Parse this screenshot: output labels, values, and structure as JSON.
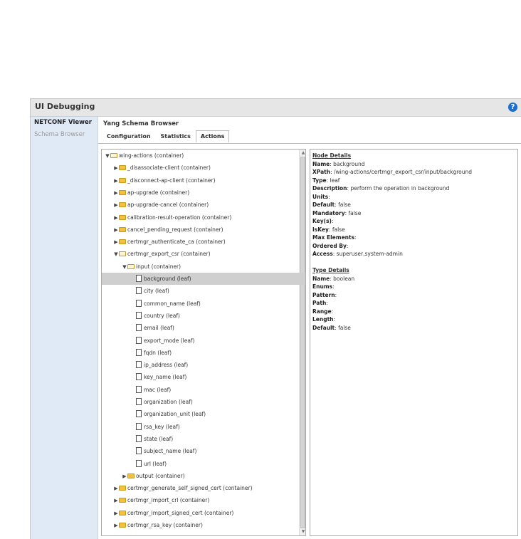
{
  "window": {
    "title": "UI Debugging",
    "help_icon": "?"
  },
  "sidebar": {
    "items": [
      {
        "label": "NETCONF Viewer",
        "active": true
      },
      {
        "label": "Schema Browser",
        "active": false
      }
    ]
  },
  "main": {
    "heading": "Yang Schema Browser",
    "tabs": [
      {
        "label": "Configuration",
        "active": false
      },
      {
        "label": "Statistics",
        "active": false
      },
      {
        "label": "Actions",
        "active": true
      }
    ]
  },
  "tree": [
    {
      "label": "wing-actions (container)",
      "depth": 0,
      "type": "folder",
      "open": true
    },
    {
      "label": "_disassociate-client (container)",
      "depth": 1,
      "type": "folder",
      "open": false
    },
    {
      "label": "_disconnect-ap-client (container)",
      "depth": 1,
      "type": "folder",
      "open": false
    },
    {
      "label": "ap-upgrade (container)",
      "depth": 1,
      "type": "folder",
      "open": false
    },
    {
      "label": "ap-upgrade-cancel (container)",
      "depth": 1,
      "type": "folder",
      "open": false
    },
    {
      "label": "calibration-result-operation (container)",
      "depth": 1,
      "type": "folder",
      "open": false
    },
    {
      "label": "cancel_pending_request (container)",
      "depth": 1,
      "type": "folder",
      "open": false
    },
    {
      "label": "certmgr_authenticate_ca (container)",
      "depth": 1,
      "type": "folder",
      "open": false
    },
    {
      "label": "certmgr_export_csr (container)",
      "depth": 1,
      "type": "folder",
      "open": true
    },
    {
      "label": "input (container)",
      "depth": 2,
      "type": "folder",
      "open": true
    },
    {
      "label": "background (leaf)",
      "depth": 3,
      "type": "leaf",
      "selected": true
    },
    {
      "label": "city (leaf)",
      "depth": 3,
      "type": "leaf"
    },
    {
      "label": "common_name (leaf)",
      "depth": 3,
      "type": "leaf"
    },
    {
      "label": "country (leaf)",
      "depth": 3,
      "type": "leaf"
    },
    {
      "label": "email (leaf)",
      "depth": 3,
      "type": "leaf"
    },
    {
      "label": "export_mode (leaf)",
      "depth": 3,
      "type": "leaf"
    },
    {
      "label": "fqdn (leaf)",
      "depth": 3,
      "type": "leaf"
    },
    {
      "label": "ip_address (leaf)",
      "depth": 3,
      "type": "leaf"
    },
    {
      "label": "key_name (leaf)",
      "depth": 3,
      "type": "leaf"
    },
    {
      "label": "mac (leaf)",
      "depth": 3,
      "type": "leaf"
    },
    {
      "label": "organization (leaf)",
      "depth": 3,
      "type": "leaf"
    },
    {
      "label": "organization_unit (leaf)",
      "depth": 3,
      "type": "leaf"
    },
    {
      "label": "rsa_key (leaf)",
      "depth": 3,
      "type": "leaf"
    },
    {
      "label": "state (leaf)",
      "depth": 3,
      "type": "leaf"
    },
    {
      "label": "subject_name (leaf)",
      "depth": 3,
      "type": "leaf"
    },
    {
      "label": "url (leaf)",
      "depth": 3,
      "type": "leaf"
    },
    {
      "label": "output (container)",
      "depth": 2,
      "type": "folder",
      "open": false
    },
    {
      "label": "certmgr_generate_self_signed_cert (container)",
      "depth": 1,
      "type": "folder",
      "open": false
    },
    {
      "label": "certmgr_import_crl (container)",
      "depth": 1,
      "type": "folder",
      "open": false
    },
    {
      "label": "certmgr_import_signed_cert (container)",
      "depth": 1,
      "type": "folder",
      "open": false
    },
    {
      "label": "certmgr_rsa_key (container)",
      "depth": 1,
      "type": "folder",
      "open": false
    }
  ],
  "details": {
    "node_title": "Node Details",
    "node": [
      {
        "k": "Name",
        "v": "background"
      },
      {
        "k": "XPath",
        "v": "/wing-actions/certmgr_export_csr/input/background"
      },
      {
        "k": "Type",
        "v": "leaf"
      },
      {
        "k": "Description",
        "v": "perform the operation in background"
      },
      {
        "k": "Units",
        "v": ""
      },
      {
        "k": "Default",
        "v": "false"
      },
      {
        "k": "Mandatory",
        "v": "false"
      },
      {
        "k": "Key(s)",
        "v": ""
      },
      {
        "k": "IsKey",
        "v": "false"
      },
      {
        "k": "Max Elements",
        "v": ""
      },
      {
        "k": "Ordered By",
        "v": ""
      },
      {
        "k": "Access",
        "v": "superuser,system-admin"
      }
    ],
    "type_title": "Type Details",
    "type": [
      {
        "k": "Name",
        "v": "boolean"
      },
      {
        "k": "Enums",
        "v": ""
      },
      {
        "k": "Pattern",
        "v": ""
      },
      {
        "k": "Path",
        "v": ""
      },
      {
        "k": "Range",
        "v": ""
      },
      {
        "k": "Length",
        "v": ""
      },
      {
        "k": "Default",
        "v": "false"
      }
    ]
  },
  "colors": {
    "sidebar_bg": "#dfeaf6",
    "help": "#1a6fd0",
    "folder": "#f3c23c",
    "selection": "#cfcfcf"
  }
}
